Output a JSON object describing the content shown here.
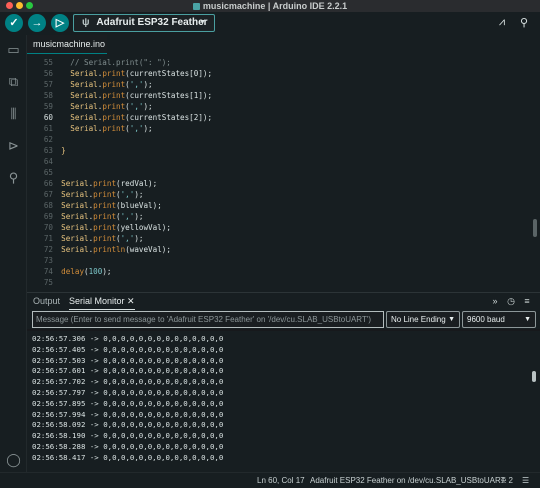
{
  "window": {
    "title": "musicmachine | Arduino IDE 2.2.1"
  },
  "toolbar": {
    "verify_icon": "checkmark-icon",
    "upload_icon": "arrow-right-icon",
    "debug_icon": "debug-icon",
    "board": "Adafruit ESP32 Feather",
    "plotter_icon": "serial-plotter-icon",
    "monitor_icon": "serial-monitor-icon"
  },
  "sidebar": {
    "items": [
      "folder-icon",
      "boards-manager-icon",
      "library-icon",
      "debug-icon",
      "search-icon"
    ],
    "account": "account-icon"
  },
  "editor": {
    "tab": "musicmachine.ino",
    "current_line": 60,
    "lines": [
      {
        "n": "55",
        "code": "    // Serial.print(\": \");"
      },
      {
        "n": "56",
        "code": "    Serial.print(currentStates[0]);"
      },
      {
        "n": "57",
        "code": "    Serial.print(',');"
      },
      {
        "n": "58",
        "code": "    Serial.print(currentStates[1]);"
      },
      {
        "n": "59",
        "code": "    Serial.print(',');"
      },
      {
        "n": "60",
        "code": "    Serial.print(currentStates[2]);"
      },
      {
        "n": "61",
        "code": "    Serial.print(',');"
      },
      {
        "n": "62",
        "code": ""
      },
      {
        "n": "63",
        "code": "  }"
      },
      {
        "n": "64",
        "code": ""
      },
      {
        "n": "65",
        "code": ""
      },
      {
        "n": "66",
        "code": "  Serial.print(redVal);"
      },
      {
        "n": "67",
        "code": "  Serial.print(',');"
      },
      {
        "n": "68",
        "code": "  Serial.print(blueVal);"
      },
      {
        "n": "69",
        "code": "  Serial.print(',');"
      },
      {
        "n": "70",
        "code": "  Serial.print(yellowVal);"
      },
      {
        "n": "71",
        "code": "  Serial.print(',');"
      },
      {
        "n": "72",
        "code": "  Serial.println(waveVal);"
      },
      {
        "n": "73",
        "code": ""
      },
      {
        "n": "74",
        "code": "  delay(100);"
      },
      {
        "n": "75",
        "code": ""
      }
    ]
  },
  "bottom": {
    "tabs": {
      "output": "Output",
      "serial_monitor": "Serial Monitor"
    },
    "close_icon": "close-icon",
    "placeholder": "Message (Enter to send message to 'Adafruit ESP32 Feather' on '/dev/cu.SLAB_USBtoUART')",
    "line_ending": "No Line Ending",
    "baud": "9600 baud",
    "serial_lines": [
      "02:56:57.306 -> 0,0,0,0,0,0,0,0,0,0,0,0,0,0",
      "02:56:57.405 -> 0,0,0,0,0,0,0,0,0,0,0,0,0,0",
      "02:56:57.503 -> 0,0,0,0,0,0,0,0,0,0,0,0,0,0",
      "02:56:57.601 -> 0,0,0,0,0,0,0,0,0,0,0,0,0,0",
      "02:56:57.702 -> 0,0,0,0,0,0,0,0,0,0,0,0,0,0",
      "02:56:57.797 -> 0,0,0,0,0,0,0,0,0,0,0,0,0,0",
      "02:56:57.895 -> 0,0,0,0,0,0,0,0,0,0,0,0,0,0",
      "02:56:57.994 -> 0,0,0,0,0,0,0,0,0,0,0,0,0,0",
      "02:56:58.092 -> 0,0,0,0,0,0,0,0,0,0,0,0,0,0",
      "02:56:58.190 -> 0,0,0,0,0,0,0,0,0,0,0,0,0,0",
      "02:56:58.288 -> 0,0,0,0,0,0,0,0,0,0,0,0,0,0",
      "02:56:58.417 -> 0,0,0,0,0,0,0,0,0,0,0,0,0,0"
    ]
  },
  "status": {
    "position": "Ln 60, Col 17",
    "board": "Adafruit ESP32 Feather on /dev/cu.SLAB_USBtoUART",
    "notifications": "2"
  },
  "colors": {
    "accent": "#008184",
    "background": "#171e21"
  }
}
